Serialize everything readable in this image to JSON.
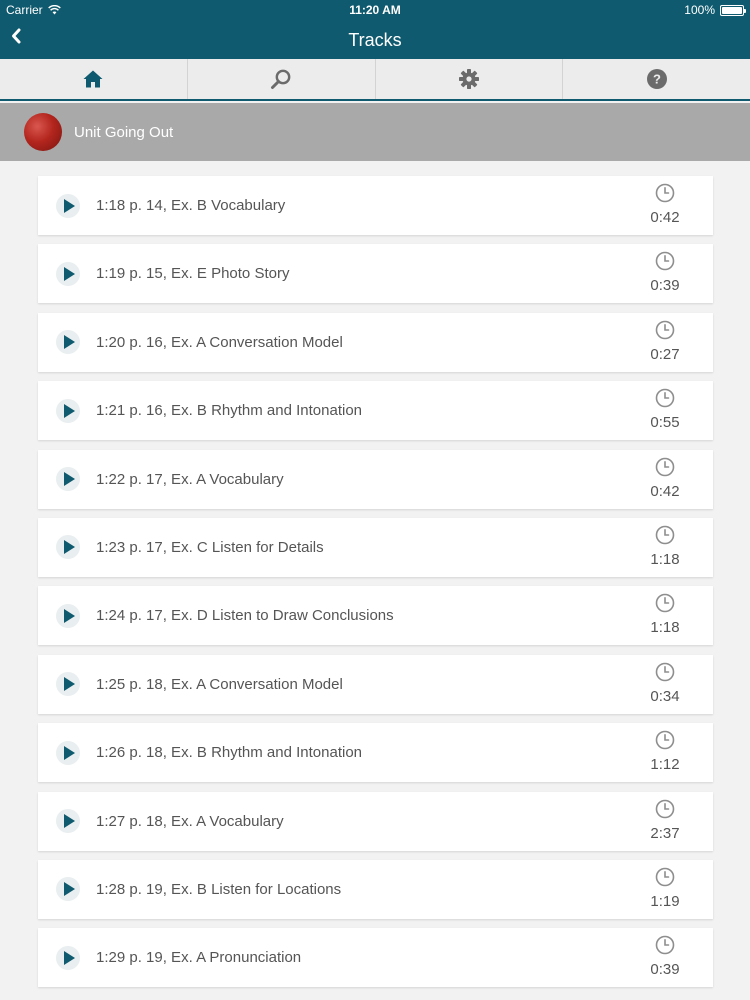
{
  "status": {
    "carrier": "Carrier",
    "time": "11:20 AM",
    "battery": "100%"
  },
  "nav": {
    "title": "Tracks",
    "back_icon": "chevron-left-icon"
  },
  "tabs": [
    {
      "name": "home",
      "icon": "home-icon"
    },
    {
      "name": "search",
      "icon": "search-icon"
    },
    {
      "name": "settings",
      "icon": "gear-icon"
    },
    {
      "name": "help",
      "icon": "help-icon"
    }
  ],
  "unit": {
    "title": "Unit Going Out"
  },
  "tracks": [
    {
      "label": "1:18 p. 14, Ex. B Vocabulary",
      "duration": "0:42"
    },
    {
      "label": "1:19 p. 15, Ex. E Photo Story",
      "duration": "0:39"
    },
    {
      "label": "1:20 p. 16, Ex. A Conversation Model",
      "duration": "0:27"
    },
    {
      "label": "1:21 p. 16, Ex. B Rhythm and Intonation",
      "duration": "0:55"
    },
    {
      "label": "1:22 p. 17, Ex. A Vocabulary",
      "duration": "0:42"
    },
    {
      "label": "1:23 p. 17, Ex. C Listen for Details",
      "duration": "1:18"
    },
    {
      "label": "1:24 p. 17, Ex. D Listen to Draw Conclusions",
      "duration": "1:18"
    },
    {
      "label": "1:25 p. 18, Ex. A Conversation Model",
      "duration": "0:34"
    },
    {
      "label": "1:26 p. 18, Ex. B Rhythm and Intonation",
      "duration": "1:12"
    },
    {
      "label": "1:27 p. 18, Ex. A Vocabulary",
      "duration": "2:37"
    },
    {
      "label": "1:28 p. 19, Ex. B Listen for Locations",
      "duration": "1:19"
    },
    {
      "label": "1:29 p. 19, Ex. A Pronunciation",
      "duration": "0:39"
    }
  ],
  "colors": {
    "brand": "#0f5a6e",
    "header_gray": "#a9a9a9",
    "icon_gray": "#6b6b6b"
  }
}
